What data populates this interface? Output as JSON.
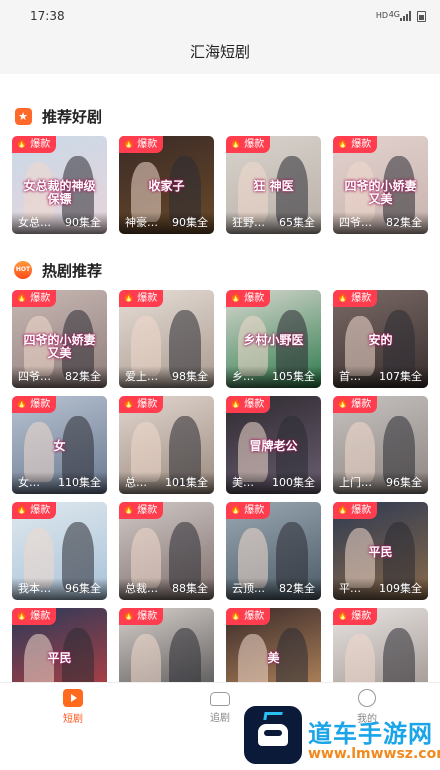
{
  "status_bar": {
    "time": "17:38",
    "network": "HD",
    "signal_type": "4G"
  },
  "header": {
    "title": "汇海短剧"
  },
  "sections": [
    {
      "title": "推荐好剧",
      "icon": "star-icon",
      "cards": [
        {
          "badge": "爆款",
          "name": "女总…",
          "episodes": "90集全",
          "art_text": "女总裁的神级保镖"
        },
        {
          "badge": "爆款",
          "name": "神豪…",
          "episodes": "90集全",
          "art_text": "收家子"
        },
        {
          "badge": "爆款",
          "name": "狂野…",
          "episodes": "65集全",
          "art_text": "狂 神医"
        },
        {
          "badge": "爆款",
          "name": "四爷…",
          "episodes": "82集全",
          "art_text": "四爷的小娇妻又美"
        }
      ]
    },
    {
      "title": "热剧推荐",
      "icon": "hot-icon",
      "icon_text": "HOT",
      "cards": [
        {
          "badge": "爆款",
          "name": "四爷…",
          "episodes": "82集全",
          "art_text": "四爷的小娇妻又美"
        },
        {
          "badge": "爆款",
          "name": "爱上…",
          "episodes": "98集全",
          "art_text": ""
        },
        {
          "badge": "爆款",
          "name": "乡…",
          "episodes": "105集全",
          "art_text": "乡村小野医"
        },
        {
          "badge": "爆款",
          "name": "首…",
          "episodes": "107集全",
          "art_text": "安的"
        },
        {
          "badge": "爆款",
          "name": "女…",
          "episodes": "110集全",
          "art_text": "女"
        },
        {
          "badge": "爆款",
          "name": "总…",
          "episodes": "101集全",
          "art_text": ""
        },
        {
          "badge": "爆款",
          "name": "美…",
          "episodes": "100集全",
          "art_text": "冒牌老公"
        },
        {
          "badge": "爆款",
          "name": "上门…",
          "episodes": "96集全",
          "art_text": ""
        },
        {
          "badge": "爆款",
          "name": "我本…",
          "episodes": "96集全",
          "art_text": ""
        },
        {
          "badge": "爆款",
          "name": "总裁…",
          "episodes": "88集全",
          "art_text": ""
        },
        {
          "badge": "爆款",
          "name": "云顶…",
          "episodes": "82集全",
          "art_text": ""
        },
        {
          "badge": "爆款",
          "name": "平…",
          "episodes": "109集全",
          "art_text": "平民"
        },
        {
          "badge": "爆款",
          "name": "",
          "episodes": "",
          "art_text": "平民"
        },
        {
          "badge": "爆款",
          "name": "",
          "episodes": "",
          "art_text": ""
        },
        {
          "badge": "爆款",
          "name": "",
          "episodes": "",
          "art_text": "美"
        },
        {
          "badge": "爆款",
          "name": "",
          "episodes": "",
          "art_text": ""
        }
      ]
    }
  ],
  "tab_bar": [
    {
      "label": "短剧",
      "icon": "play-icon",
      "active": true
    },
    {
      "label": "追剧",
      "icon": "sofa-icon",
      "active": false
    },
    {
      "label": "我的",
      "icon": "face-icon",
      "active": false
    }
  ],
  "watermark": {
    "title": "道车手游网",
    "url": "www.lmwwsz.com"
  },
  "colors": {
    "accent": "#ff5a1f",
    "badge": "#ff3d4f",
    "watermark_blue": "#1aa5e8",
    "watermark_orange": "#f08a1e"
  }
}
